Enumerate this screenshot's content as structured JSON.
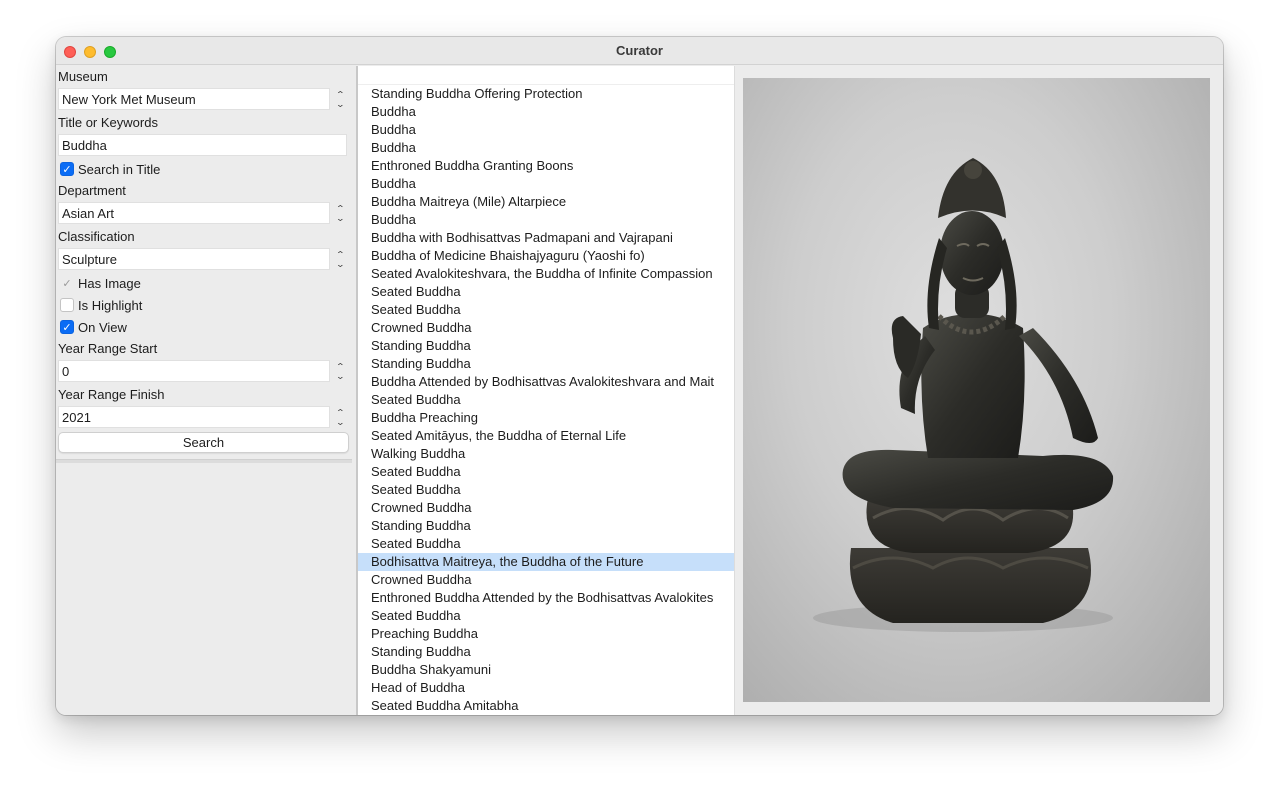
{
  "window": {
    "title": "Curator"
  },
  "form": {
    "museum_label": "Museum",
    "museum_value": "New York Met Museum",
    "keywords_label": "Title or Keywords",
    "keywords_value": "Buddha",
    "search_in_title_label": "Search in Title",
    "search_in_title_checked": true,
    "department_label": "Department",
    "department_value": "Asian Art",
    "classification_label": "Classification",
    "classification_value": "Sculpture",
    "has_image_label": "Has Image",
    "has_image_checked": true,
    "is_highlight_label": "Is Highlight",
    "is_highlight_checked": false,
    "on_view_label": "On View",
    "on_view_checked": true,
    "year_start_label": "Year Range Start",
    "year_start_value": "0",
    "year_finish_label": "Year Range Finish",
    "year_finish_value": "2021",
    "search_button": "Search"
  },
  "results": {
    "selected_index": 26,
    "items": [
      "Standing Buddha Offering Protection",
      "Buddha",
      "Buddha",
      "Buddha",
      "Enthroned Buddha Granting Boons",
      "Buddha",
      "Buddha Maitreya (Mile) Altarpiece",
      "Buddha",
      "Buddha with Bodhisattvas Padmapani and Vajrapani",
      "Buddha of Medicine Bhaishajyaguru (Yaoshi fo)",
      "Seated Avalokiteshvara, the Buddha of Infinite Compassion",
      "Seated Buddha",
      "Seated Buddha",
      "Crowned Buddha",
      "Standing Buddha",
      "Standing Buddha",
      "Buddha Attended by Bodhisattvas Avalokiteshvara and Mait",
      "Seated Buddha",
      "Buddha Preaching",
      "Seated Amitāyus, the Buddha of Eternal Life",
      "Walking Buddha",
      "Seated Buddha",
      "Seated Buddha",
      "Crowned Buddha",
      "Standing Buddha",
      "Seated Buddha",
      "Bodhisattva Maitreya, the Buddha of the Future",
      "Crowned  Buddha",
      "Enthroned Buddha Attended by the Bodhisattvas Avalokites",
      "Seated Buddha",
      "Preaching Buddha",
      "Standing Buddha",
      "Buddha Shakyamuni",
      "Head of Buddha",
      "Seated Buddha Amitabha"
    ]
  },
  "preview": {
    "icon": "bronze-bodhisattva-sculpture"
  }
}
